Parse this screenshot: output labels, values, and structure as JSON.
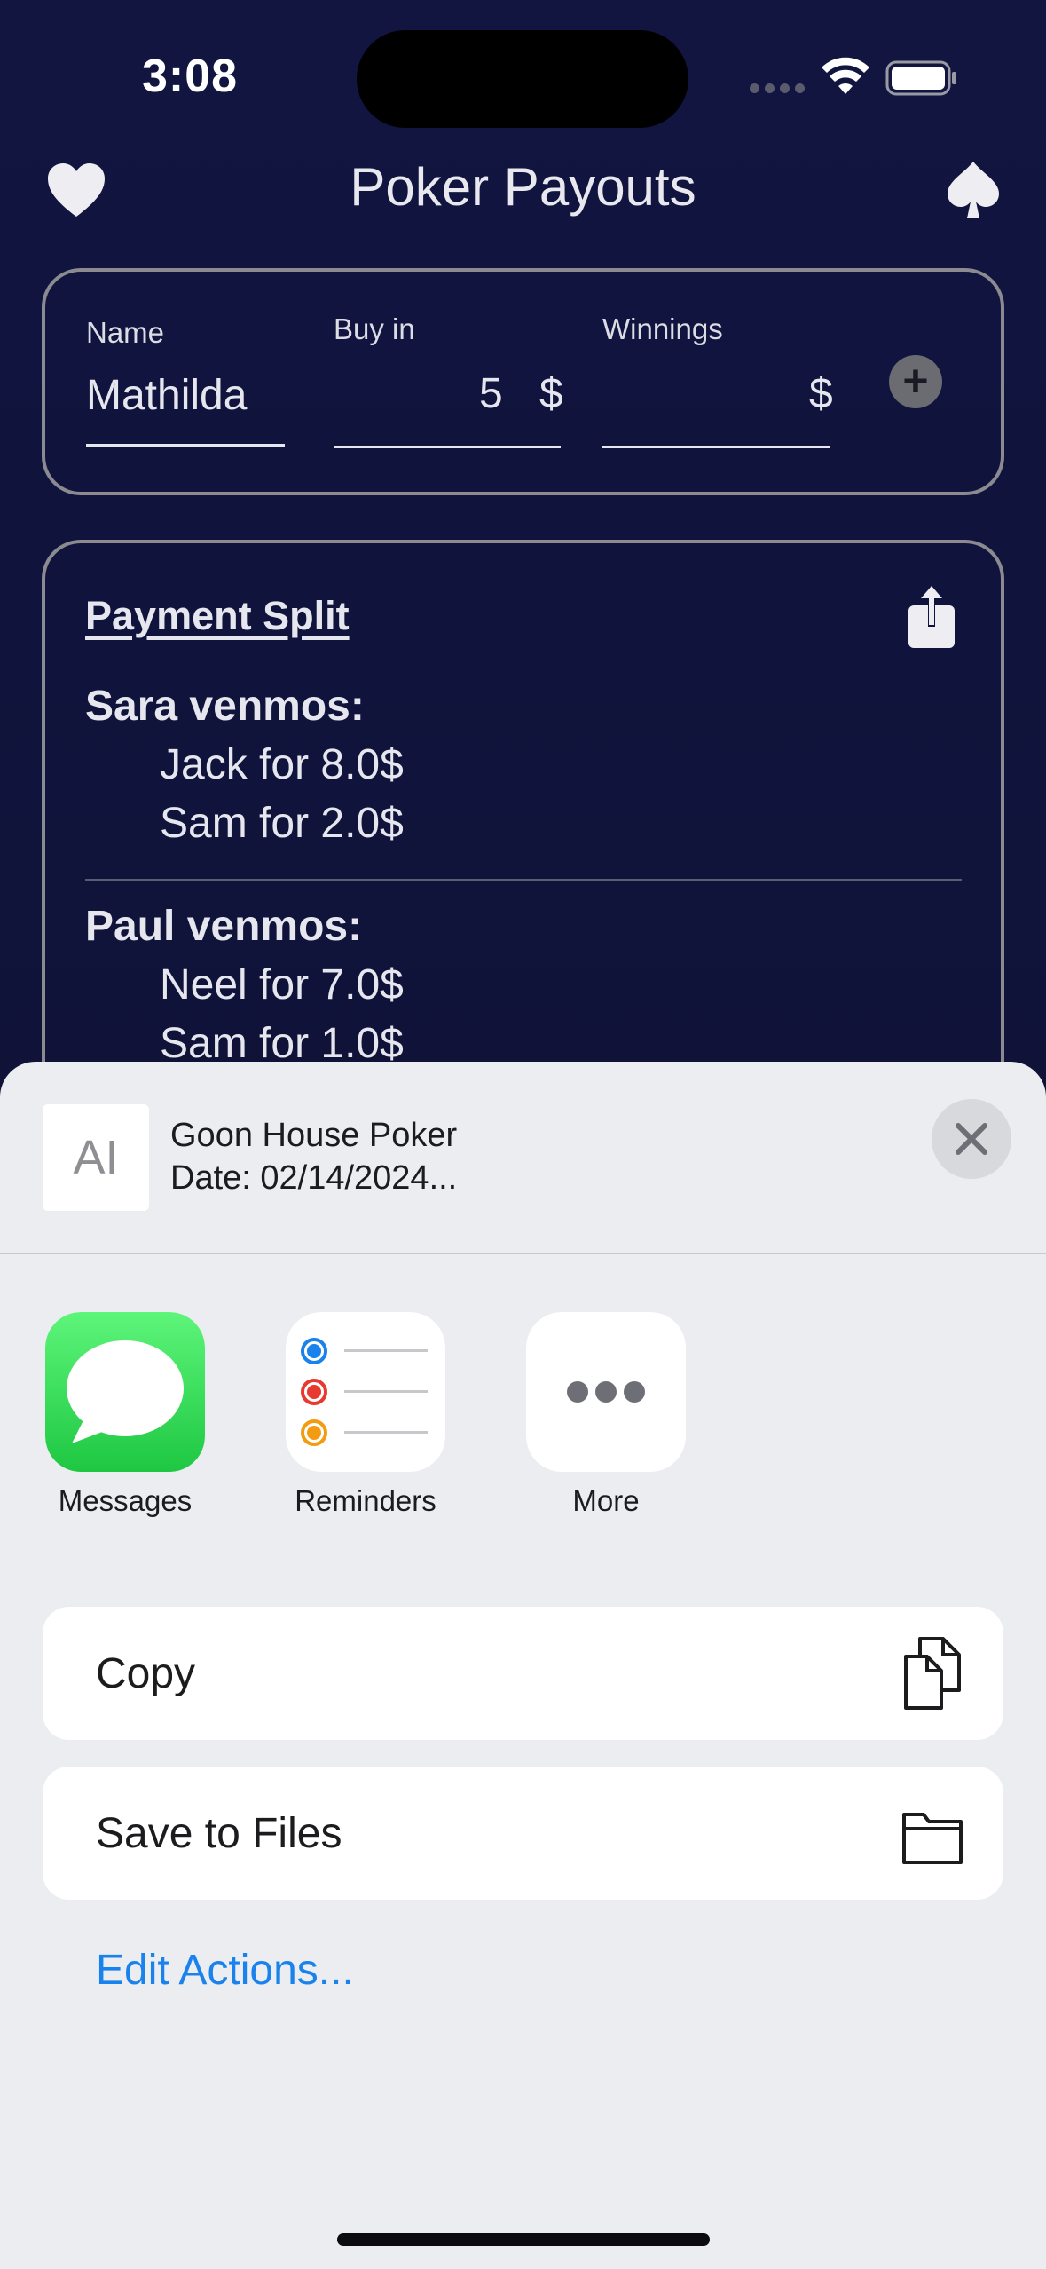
{
  "status_bar": {
    "time": "3:08"
  },
  "header": {
    "title": "Poker Payouts"
  },
  "entry": {
    "name_label": "Name",
    "name_value": "Mathilda",
    "buyin_label": "Buy in",
    "buyin_value": "5",
    "currency": "$",
    "winnings_label": "Winnings",
    "winnings_value": ""
  },
  "split": {
    "title": "Payment Split",
    "groups": [
      {
        "payer": "Sara venmos:",
        "payees": [
          "Jack for 8.0$",
          "Sam for 2.0$"
        ]
      },
      {
        "payer": "Paul venmos:",
        "payees": [
          "Neel for 7.0$",
          "Sam for 1.0$"
        ]
      }
    ]
  },
  "share_sheet": {
    "doc_title": "Goon House Poker",
    "doc_subtitle": "Date: 02/14/2024...",
    "thumb_glyph": "A",
    "apps": [
      {
        "label": "Messages",
        "icon": "messages-icon"
      },
      {
        "label": "Reminders",
        "icon": "reminders-icon"
      },
      {
        "label": "More",
        "icon": "more-icon"
      }
    ],
    "actions": [
      {
        "label": "Copy",
        "icon": "copy-icon"
      },
      {
        "label": "Save to Files",
        "icon": "folder-icon"
      }
    ],
    "edit_actions": "Edit Actions..."
  },
  "colors": {
    "background": "#111540",
    "sheet": "#ebedf1",
    "link_blue": "#1a82ec",
    "messages_green": "#34c759"
  }
}
